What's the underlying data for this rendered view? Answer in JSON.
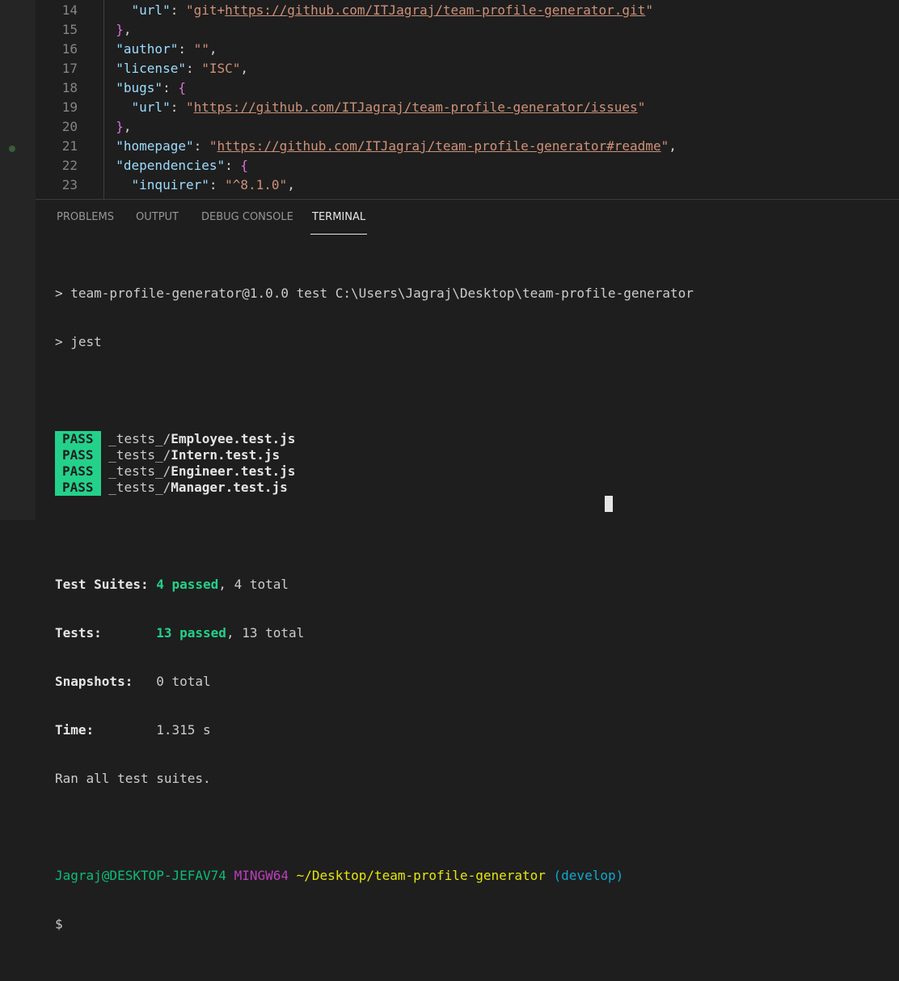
{
  "editor": {
    "lines": [
      {
        "num": "14",
        "indent": "    ",
        "parts": [
          {
            "t": "\"url\"",
            "c": "k"
          },
          {
            "t": ": ",
            "c": "p"
          },
          {
            "t": "\"git+",
            "c": "s"
          },
          {
            "t": "https://github.com/ITJagraj/team-profile-generator.git",
            "c": "u"
          },
          {
            "t": "\"",
            "c": "s"
          }
        ]
      },
      {
        "num": "15",
        "indent": "  ",
        "parts": [
          {
            "t": "}",
            "c": "b1"
          },
          {
            "t": ",",
            "c": "p"
          }
        ]
      },
      {
        "num": "16",
        "indent": "  ",
        "parts": [
          {
            "t": "\"author\"",
            "c": "k"
          },
          {
            "t": ": ",
            "c": "p"
          },
          {
            "t": "\"\"",
            "c": "s"
          },
          {
            "t": ",",
            "c": "p"
          }
        ]
      },
      {
        "num": "17",
        "indent": "  ",
        "parts": [
          {
            "t": "\"license\"",
            "c": "k"
          },
          {
            "t": ": ",
            "c": "p"
          },
          {
            "t": "\"ISC\"",
            "c": "s"
          },
          {
            "t": ",",
            "c": "p"
          }
        ]
      },
      {
        "num": "18",
        "indent": "  ",
        "parts": [
          {
            "t": "\"bugs\"",
            "c": "k"
          },
          {
            "t": ": ",
            "c": "p"
          },
          {
            "t": "{",
            "c": "b1"
          }
        ]
      },
      {
        "num": "19",
        "indent": "    ",
        "parts": [
          {
            "t": "\"url\"",
            "c": "k"
          },
          {
            "t": ": ",
            "c": "p"
          },
          {
            "t": "\"",
            "c": "s"
          },
          {
            "t": "https://github.com/ITJagraj/team-profile-generator/issues",
            "c": "u"
          },
          {
            "t": "\"",
            "c": "s"
          }
        ]
      },
      {
        "num": "20",
        "indent": "  ",
        "parts": [
          {
            "t": "}",
            "c": "b1"
          },
          {
            "t": ",",
            "c": "p"
          }
        ]
      },
      {
        "num": "21",
        "indent": "  ",
        "parts": [
          {
            "t": "\"homepage\"",
            "c": "k"
          },
          {
            "t": ": ",
            "c": "p"
          },
          {
            "t": "\"",
            "c": "s"
          },
          {
            "t": "https://github.com/ITJagraj/team-profile-generator#readme",
            "c": "u"
          },
          {
            "t": "\"",
            "c": "s"
          },
          {
            "t": ",",
            "c": "p"
          }
        ]
      },
      {
        "num": "22",
        "indent": "  ",
        "parts": [
          {
            "t": "\"dependencies\"",
            "c": "k"
          },
          {
            "t": ": ",
            "c": "p"
          },
          {
            "t": "{",
            "c": "b1"
          }
        ]
      },
      {
        "num": "23",
        "indent": "    ",
        "parts": [
          {
            "t": "\"inquirer\"",
            "c": "k"
          },
          {
            "t": ": ",
            "c": "p"
          },
          {
            "t": "\"^8.1.0\"",
            "c": "s"
          },
          {
            "t": ",",
            "c": "p"
          }
        ]
      }
    ]
  },
  "panel": {
    "tabs": [
      {
        "id": "problems",
        "label": "PROBLEMS"
      },
      {
        "id": "output",
        "label": "OUTPUT"
      },
      {
        "id": "debug-console",
        "label": "DEBUG CONSOLE"
      },
      {
        "id": "terminal",
        "label": "TERMINAL",
        "active": true
      }
    ]
  },
  "terminal": {
    "script_line": "> team-profile-generator@1.0.0 test C:\\Users\\Jagraj\\Desktop\\team-profile-generator",
    "command_line": "> jest",
    "pass_label": "PASS",
    "tests": [
      {
        "dir": "_tests_/",
        "file": "Employee.test.js"
      },
      {
        "dir": "_tests_/",
        "file": "Intern.test.js"
      },
      {
        "dir": "_tests_/",
        "file": "Engineer.test.js"
      },
      {
        "dir": "_tests_/",
        "file": "Manager.test.js"
      }
    ],
    "summary": {
      "suites_label": "Test Suites:",
      "suites_passed": "4 passed",
      "suites_total": ", 4 total",
      "tests_label": "Tests:",
      "tests_passed": "13 passed",
      "tests_total": ", 13 total",
      "snapshots_label": "Snapshots:",
      "snapshots_value": "0 total",
      "time_label": "Time:",
      "time_value": "1.315 s",
      "ran_all": "Ran all test suites."
    },
    "prompt": {
      "user_host": "Jagraj@DESKTOP-JEFAV74",
      "system": "MINGW64",
      "path": "~/Desktop/team-profile-generator",
      "branch": "(develop)",
      "symbol": "$"
    }
  }
}
